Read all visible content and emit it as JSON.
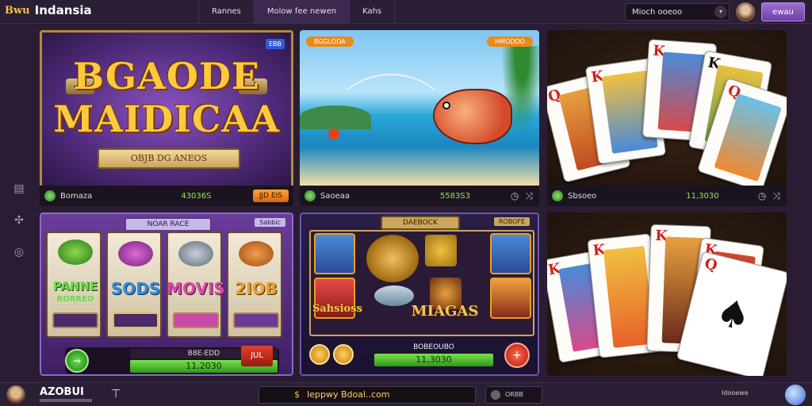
{
  "header": {
    "logo_mark": "Bwu",
    "brand": "Indansia",
    "tabs": [
      "Rannes",
      "Molow fee newen",
      "Kahs"
    ],
    "search_value": "Mioch ooeoo",
    "action_label": "ewau"
  },
  "sidebar": {
    "icons": [
      "calculator-icon",
      "shuffle-icon",
      "compass-icon"
    ]
  },
  "games": [
    {
      "title_line1": "BGAODE",
      "title_line2": "MAIDICAA",
      "subtitle": "OBJB DG ANEOS",
      "tag": "EBB",
      "footer_label": "Bomaza",
      "footer_value": "43036S",
      "footer_button": "JJD EIS"
    },
    {
      "tag_left": "BGGLODA",
      "tag_right": "HMODDO",
      "footer_label": "Saoeaa",
      "footer_value": "5583S3"
    },
    {
      "footer_label": "Sbsoeo",
      "footer_value": "11,3030",
      "card_ranks": [
        "Q",
        "K",
        "K",
        "K",
        "Q"
      ]
    },
    {
      "title": "NOAR RACE",
      "tag": "Sabbic",
      "reel_words": [
        "PANNE",
        "SODS",
        "MOVIS",
        "2IOB"
      ],
      "reel_sub": "RORREO",
      "footer_label": "B8E-EDD",
      "footer_value": "11,2030",
      "footer_button": "JUL"
    },
    {
      "title": "DAEBOCK",
      "tag": "ROBOFE",
      "word_main": "MIAGAS",
      "word_side": "Sahsioss",
      "footer_label": "BOBEOUBO",
      "footer_value": "11,3030"
    },
    {
      "card_ranks": [
        "K",
        "K",
        "K",
        "K",
        "Q"
      ]
    }
  ],
  "footer": {
    "username": "AZOBUI",
    "url_text": "Ieppwy Bdoal..com",
    "chat_label": "ORBB",
    "right_label": "Idooewe"
  },
  "colors": {
    "accent_purple": "#8a5ad0",
    "accent_green": "#6ad84a",
    "accent_orange": "#e98a1c",
    "bg": "#2a1d33"
  }
}
